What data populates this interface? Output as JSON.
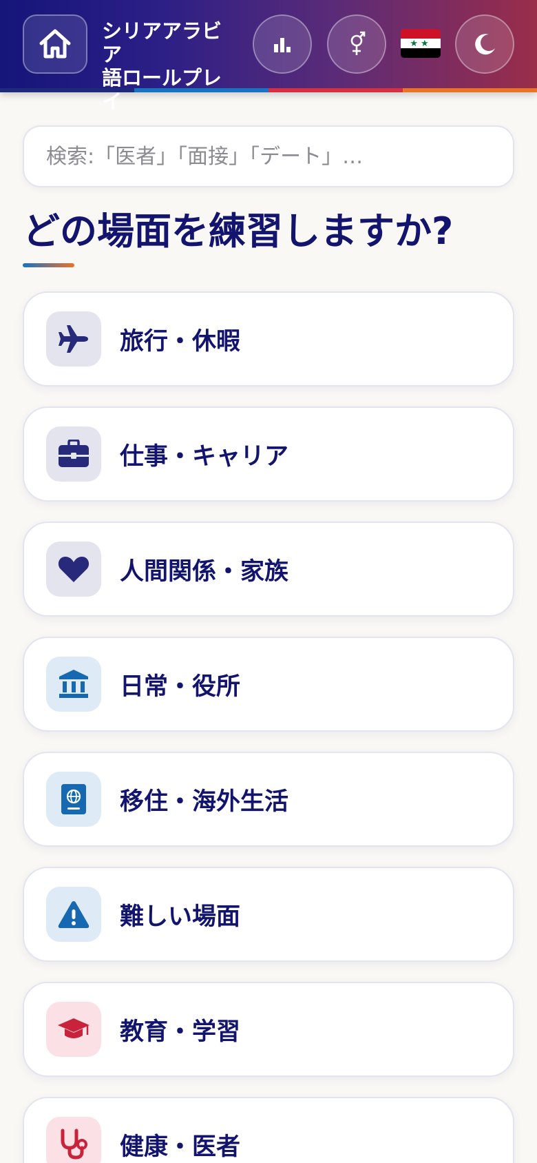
{
  "header": {
    "title": "シリアアラビア\n語ロールプレイ",
    "home_icon": "home-icon",
    "stats_icon": "bar-chart-icon",
    "gender_icon": "gender-icon",
    "flag_icon": "syria-flag-icon",
    "theme_icon": "moon-icon",
    "stripe_colors": [
      "#1f2a7c",
      "#1a73c0",
      "#d32f45",
      "#e8742a"
    ]
  },
  "search": {
    "placeholder": "検索:「医者」「面接」「デート」…",
    "value": ""
  },
  "main": {
    "heading": "どの場面を練習しますか?"
  },
  "categories": [
    {
      "label": "旅行・休暇",
      "icon": "airplane-icon",
      "icon_color": "#27297a",
      "icon_bg": "#e4e4ef"
    },
    {
      "label": "仕事・キャリア",
      "icon": "briefcase-icon",
      "icon_color": "#27297a",
      "icon_bg": "#e4e4ef"
    },
    {
      "label": "人間関係・家族",
      "icon": "heart-icon",
      "icon_color": "#27297a",
      "icon_bg": "#e4e4ef"
    },
    {
      "label": "日常・役所",
      "icon": "government-building-icon",
      "icon_color": "#1669b0",
      "icon_bg": "#deebf6"
    },
    {
      "label": "移住・海外生活",
      "icon": "passport-icon",
      "icon_color": "#1669b0",
      "icon_bg": "#deebf6"
    },
    {
      "label": "難しい場面",
      "icon": "warning-icon",
      "icon_color": "#1669b0",
      "icon_bg": "#deebf6"
    },
    {
      "label": "教育・学習",
      "icon": "graduation-cap-icon",
      "icon_color": "#c8233a",
      "icon_bg": "#fbe1e5"
    },
    {
      "label": "健康・医者",
      "icon": "stethoscope-icon",
      "icon_color": "#c8233a",
      "icon_bg": "#fbe1e5"
    }
  ]
}
